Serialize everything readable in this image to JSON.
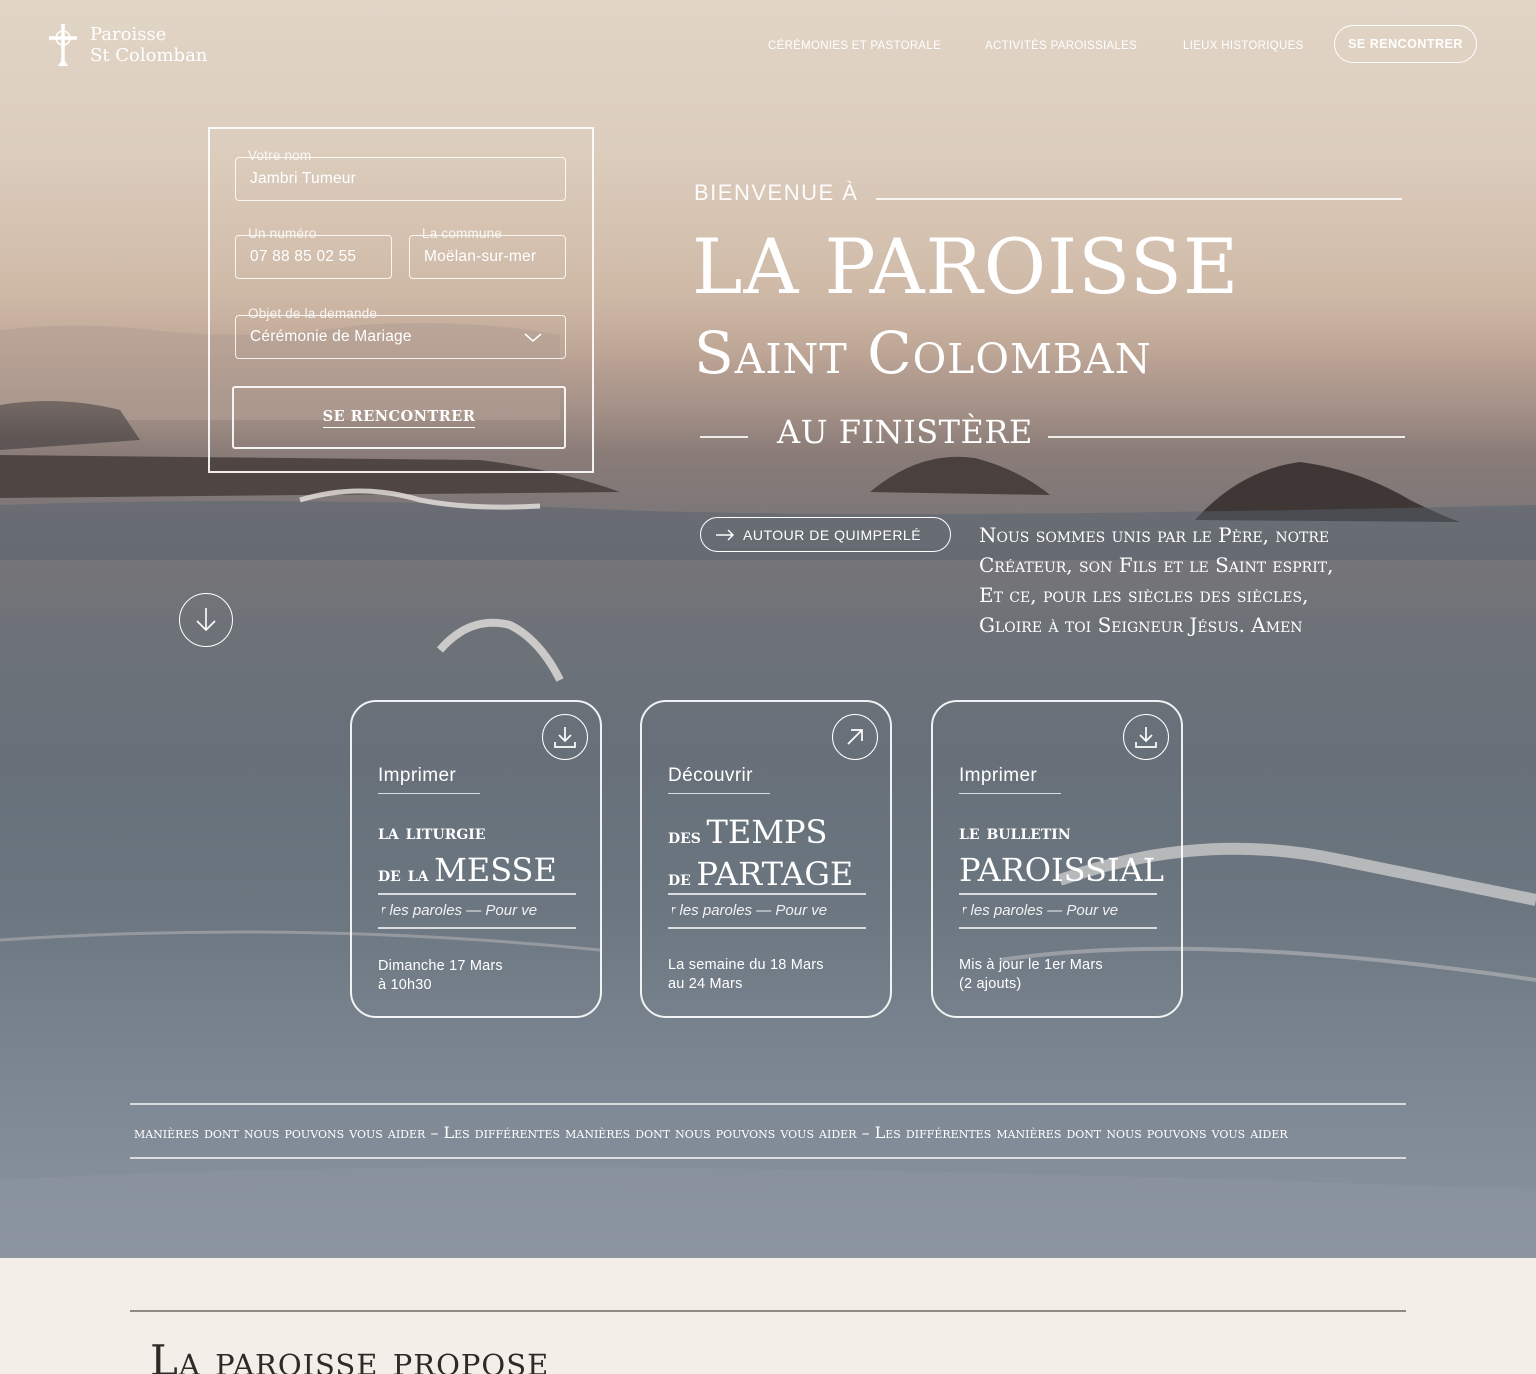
{
  "header": {
    "logo_line1": "Paroisse",
    "logo_line2": "St Colomban",
    "nav": [
      "CÉRÉMONIES ET PASTORALE",
      "ACTIVITÉS PAROISSIALES",
      "LIEUX HISTORIQUES"
    ],
    "cta": "SE RENCONTRER"
  },
  "form": {
    "name_label": "Votre nom",
    "name_value": "Jambri Tumeur",
    "phone_label": "Un numéro",
    "phone_value": "07 88 85 02 55",
    "town_label": "La commune",
    "town_value": "Moëlan-sur-mer",
    "subject_label": "Objet de la demande",
    "subject_value": "Cérémonie de Mariage",
    "submit": "SE RENCONTRER"
  },
  "hero": {
    "kicker": "BIENVENUE À",
    "title_line1": "LA PAROISSE",
    "title_line2": "Saint Colomban",
    "title_line3": "AU FINISTÈRE",
    "pill": "AUTOUR DE QUIMPERLÉ",
    "prayer": [
      "Nous sommes unis par le Père, notre",
      "Créateur, son Fils et le Saint esprit,",
      "Et ce, pour les siècles des siècles,",
      "Gloire à toi Seigneur Jésus. Amen"
    ]
  },
  "cards": [
    {
      "kicker": "Imprimer",
      "title_small_1": "la liturgie",
      "title_small_2": "de la",
      "title_large": "MESSE",
      "marquee": "er les paroles  —  Pour ve",
      "info_line1": "Dimanche 17 Mars",
      "info_line2": "à 10h30",
      "icon": "download-icon"
    },
    {
      "kicker": "Découvrir",
      "title_small_1": "des",
      "title_large_1": "TEMPS",
      "title_small_2": "de",
      "title_large": "PARTAGE",
      "marquee": "er les paroles  —  Pour ve",
      "info_line1": "La semaine du 18 Mars",
      "info_line2": "au 24 Mars",
      "icon": "arrow-up-right-icon"
    },
    {
      "kicker": "Imprimer",
      "title_small_1": "le bulletin",
      "title_large": "PAROISSIAL",
      "marquee": "er les paroles  —  Pour ve",
      "info_line1": "Mis à jour le 1er Mars",
      "info_line2": "(2 ajouts)",
      "icon": "download-icon"
    }
  ],
  "band": {
    "text": "érentes manières dont nous pouvons vous aider – Les différentes manières dont nous pouvons vous aider – Les différentes manières dont nous pouvons vous aider"
  },
  "lower": {
    "title": "La paroisse propose"
  },
  "colors": {
    "sky_top": "#e1d5c6",
    "sea": "#6d7278",
    "page_bg": "#f3efe8",
    "text_dark": "#2d2a27"
  }
}
